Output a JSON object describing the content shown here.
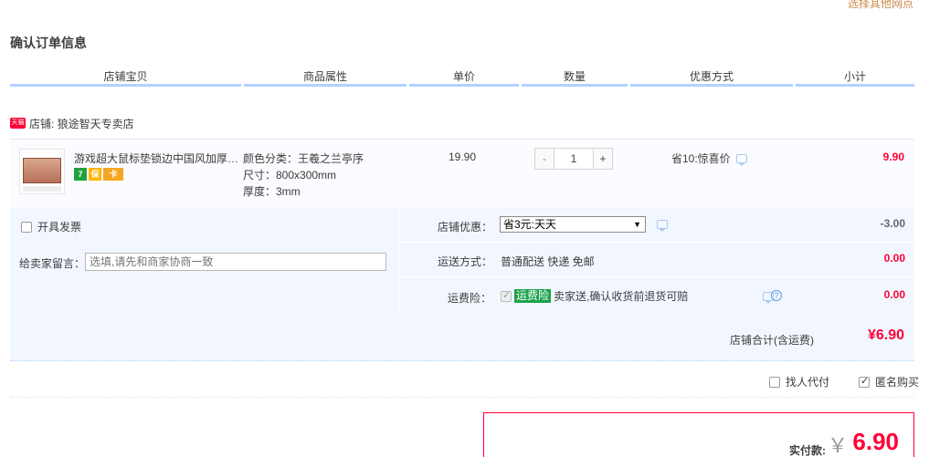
{
  "top_link": "选择其他网点",
  "page_title": "确认订单信息",
  "columns": [
    "店铺宝贝",
    "商品属性",
    "单价",
    "数量",
    "优惠方式",
    "小计"
  ],
  "shop": {
    "badge": "天猫",
    "label": "店铺: 狼途智天专卖店"
  },
  "item": {
    "name": "游戏超大鼠标垫锁边中国风加厚桌垫",
    "service_icons": [
      "7",
      "保",
      "卡"
    ],
    "props": [
      "颜色分类：王羲之兰亭序",
      "尺寸：800x300mm",
      "厚度：3mm"
    ],
    "price": "19.90",
    "qty": {
      "minus": "-",
      "value": "1",
      "plus": "+"
    },
    "promo": "省10:惊喜价",
    "subtotal": "9.90"
  },
  "extras": {
    "invoice_label": "开具发票",
    "message_label": "给卖家留言：",
    "message_placeholder": "选填,请先和商家协商一致",
    "shop_discount_label": "店铺优惠：",
    "shop_discount_selected": "省3元:天天",
    "shop_discount_amount": "-3.00",
    "shipping_label": "运送方式：",
    "shipping_value": "普通配送 快递 免邮",
    "shipping_amount": "0.00",
    "insurance_label": "运费险：",
    "insurance_badge": "运费险",
    "insurance_text": "卖家送,确认收货前退货可赔",
    "insurance_amount": "0.00"
  },
  "shop_total": {
    "label": "店铺合计(含运费)",
    "value": "¥6.90"
  },
  "options": {
    "proxy_pay": "找人代付",
    "anonymous": "匿名购买"
  },
  "payment": {
    "label": "实付款:",
    "currency": "￥",
    "value": "6.90"
  }
}
